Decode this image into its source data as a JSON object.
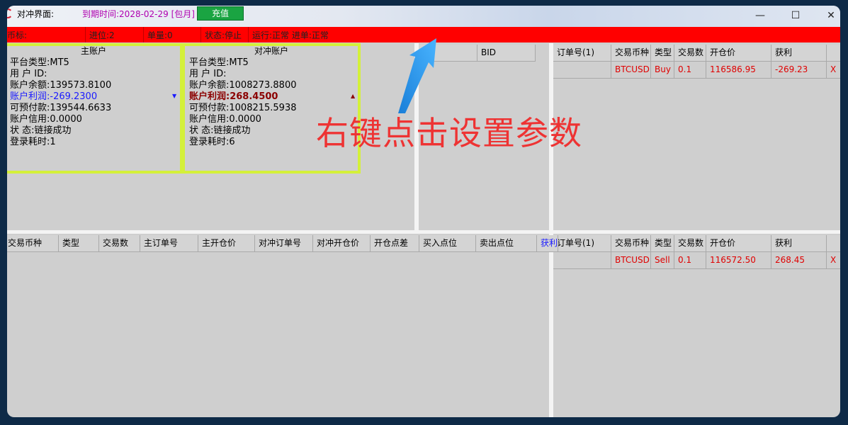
{
  "window": {
    "title": "对冲界面:",
    "expiry": "到期时间:2028-02-29 [包月]",
    "recharge_label": "充值",
    "minimize": "—",
    "maximize": "☐",
    "close": "✕"
  },
  "status_bar": {
    "symbol": "币标:",
    "position": "进位:2",
    "orders": "单量:0",
    "state": "状态:停止",
    "run": "运行:正常 进单:正常"
  },
  "main_account": {
    "header": "主账户",
    "platform": "平台类型:MT5",
    "user_id": "用 户 ID:",
    "balance": "账户余额:139573.8100",
    "profit": "账户利润:-269.2300",
    "free_margin": "可预付款:139544.6633",
    "credit": "账户信用:0.0000",
    "status": "状 态:链接成功",
    "login_time": "登录耗时:1",
    "trend_icon": "triangle-down-icon",
    "profit_color": "#1a1aff"
  },
  "hedge_account": {
    "header": "对冲账户",
    "platform": "平台类型:MT5",
    "user_id": "用 户 ID:",
    "balance": "账户余额:1008273.8800",
    "profit": "账户利润:268.4500",
    "free_margin": "可预付款:1008215.5938",
    "credit": "账户信用:0.0000",
    "status": "状 态:链接成功",
    "login_time": "登录耗时:6",
    "trend_icon": "triangle-up-icon",
    "profit_color": "#8b0000"
  },
  "quote_panel": {
    "bid_header": "BID"
  },
  "top_orders": {
    "headers": [
      "订单号(1)",
      "交易币种",
      "类型",
      "交易数",
      "开仓价",
      "获利"
    ],
    "rows": [
      {
        "symbol": "BTCUSD",
        "type": "Buy",
        "volume": "0.1",
        "open_price": "116586.95",
        "profit": "-269.23",
        "close": "X"
      }
    ]
  },
  "hedge_table": {
    "headers": [
      "交易币种",
      "类型",
      "交易数",
      "主订单号",
      "主开仓价",
      "对冲订单号",
      "对冲开仓价",
      "开仓点差",
      "买入点位",
      "卖出点位",
      "获利"
    ]
  },
  "bottom_orders": {
    "headers": [
      "订单号(1)",
      "交易币种",
      "类型",
      "交易数",
      "开仓价",
      "获利"
    ],
    "rows": [
      {
        "symbol": "BTCUSD",
        "type": "Sell",
        "volume": "0.1",
        "open_price": "116572.50",
        "profit": "268.45",
        "close": "X"
      }
    ]
  },
  "overlay": {
    "text": "右键点击设置参数",
    "color": "#ee3333",
    "arrow_icon": "blue-arrow-icon"
  }
}
